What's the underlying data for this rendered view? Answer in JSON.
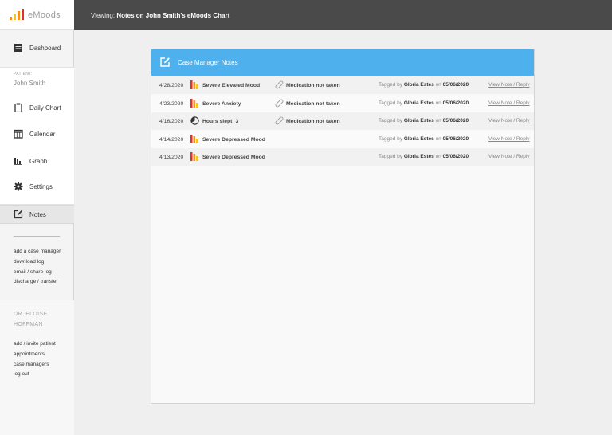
{
  "app": {
    "logo_text": "eMoods"
  },
  "header": {
    "prefix": "Viewing:",
    "title": "Notes on John Smith's eMoods Chart"
  },
  "sidebar": {
    "dashboard_label": "Dashboard",
    "patient_caption": "PATIENT:",
    "patient_name": "John Smith",
    "items": [
      {
        "label": "Daily Chart",
        "icon": "clipboard-icon"
      },
      {
        "label": "Calendar",
        "icon": "calendar-icon"
      },
      {
        "label": "Graph",
        "icon": "bar-graph-icon"
      },
      {
        "label": "Settings",
        "icon": "gear-icon"
      },
      {
        "label": "Notes",
        "icon": "edit-note-icon",
        "active": true
      }
    ],
    "patient_links": [
      "add a case manager",
      "download log",
      "email / share log",
      "discharge / transfer"
    ],
    "doctor_name": "DR. ELOISE HOFFMAN",
    "doctor_links": [
      "add / invite patient",
      "appointments",
      "case managers",
      "log out"
    ]
  },
  "panel": {
    "title": "Case Manager Notes",
    "rows": [
      {
        "date": "4/28/2020",
        "mood_icon": "mood-bars-icon",
        "mood": "Severe Elevated Mood",
        "med": "Medication not taken",
        "tagged_prefix": "Tagged by",
        "tagged_by": "Gloria Estes",
        "on": "on",
        "tag_date": "05/06/2020",
        "link": "View Note / Reply"
      },
      {
        "date": "4/23/2020",
        "mood_icon": "mood-bars-icon",
        "mood": "Severe Anxiety",
        "med": "Medication not taken",
        "tagged_prefix": "Tagged by",
        "tagged_by": "Gloria Estes",
        "on": "on",
        "tag_date": "05/06/2020",
        "link": "View Note / Reply"
      },
      {
        "date": "4/16/2020",
        "mood_icon": "sleep-clock-icon",
        "mood": "Hours slept: 3",
        "med": "Medication not taken",
        "tagged_prefix": "Tagged by",
        "tagged_by": "Gloria Estes",
        "on": "on",
        "tag_date": "05/06/2020",
        "link": "View Note / Reply"
      },
      {
        "date": "4/14/2020",
        "mood_icon": "mood-bars-icon",
        "mood": "Severe Depressed Mood",
        "med": "",
        "tagged_prefix": "Tagged by",
        "tagged_by": "Gloria Estes",
        "on": "on",
        "tag_date": "05/06/2020",
        "link": "View Note / Reply"
      },
      {
        "date": "4/13/2020",
        "mood_icon": "mood-bars-icon",
        "mood": "Severe Depressed Mood",
        "med": "",
        "tagged_prefix": "Tagged by",
        "tagged_by": "Gloria Estes",
        "on": "on",
        "tag_date": "05/06/2020",
        "link": "View Note / Reply"
      }
    ]
  },
  "colors": {
    "header_bg": "#4a4a4a",
    "panel_head": "#4eb1ee",
    "mood_red": "#e2332b",
    "mood_orange": "#f0932b",
    "mood_yellow": "#f5c518"
  }
}
